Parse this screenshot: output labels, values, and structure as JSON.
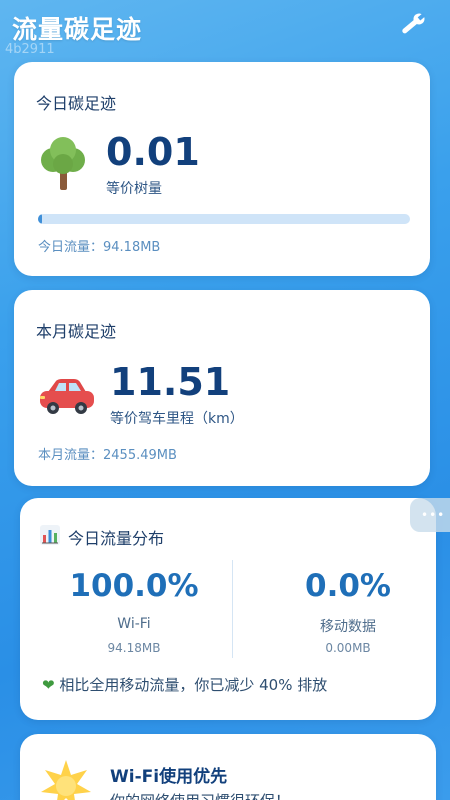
{
  "app": {
    "title": "流量碳足迹",
    "id_text": "4b2911",
    "tool_icon": "wrench-icon"
  },
  "today_card": {
    "title": "今日碳足迹",
    "value": "0.01",
    "unit_label": "等价树量",
    "progress": 0.01,
    "flow_label": "今日流量：94.18MB",
    "icon": "tree-icon"
  },
  "month_card": {
    "title": "本月碳足迹",
    "value": "11.51",
    "unit_label": "等价驾车里程（km）",
    "flow_label": "本月流量：2455.49MB",
    "icon": "car-icon"
  },
  "distribution_card": {
    "title": "今日流量分布",
    "icon": "bar-chart-icon",
    "wifi": {
      "percent": "100.0%",
      "label": "Wi-Fi",
      "size": "94.18MB"
    },
    "mobile": {
      "percent": "0.0%",
      "label": "移动数据",
      "size": "0.00MB"
    },
    "tip": "相比全用移动流量，你已减少 40% 排放",
    "tip_icon": "green-heart-icon"
  },
  "wifi_card": {
    "title": "Wi-Fi使用优先",
    "subtitle": "你的网络使用习惯很环保！",
    "icon": "sun-icon"
  },
  "colors": {
    "accent": "#1f6fb8",
    "value_text": "#12407c",
    "progress_fill": "#3f8fd8",
    "progress_track": "#cfe4f8"
  }
}
